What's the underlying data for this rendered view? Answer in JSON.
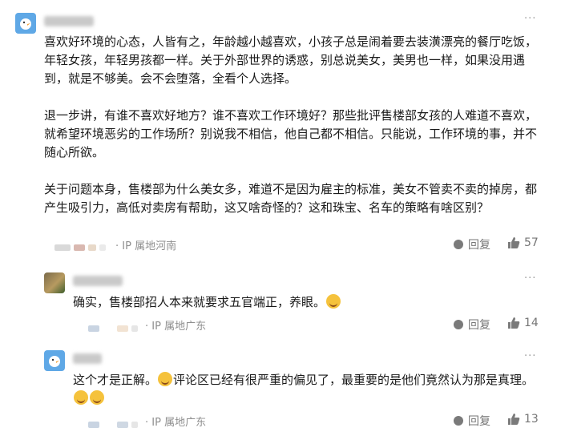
{
  "comments": [
    {
      "ip": "· IP 属地河南",
      "para1": "喜欢好环境的心态，人皆有之，年龄越小越喜欢，小孩子总是闹着要去装潢漂亮的餐厅吃饭，年轻女孩，年轻男孩都一样。关于外部世界的诱惑，别总说美女，美男也一样，如果没用遇到，就是不够美。会不会堕落，全看个人选择。",
      "para2": "退一步讲，有谁不喜欢好地方？谁不喜欢工作环境好？那些批评售楼部女孩的人难道不喜欢，就希望环境恶劣的工作场所？别说我不相信，他自己都不相信。只能说，工作环境的事，并不随心所欲。",
      "para3": "关于问题本身，售楼部为什么美女多，难道不是因为雇主的标准，美女不管卖不卖的掉房，都产生吸引力，高低对卖房有帮助，这又啥奇怪的？这和珠宝、名车的策略有啥区别？",
      "reply_label": "回复",
      "likes": "57"
    },
    {
      "ip": "· IP 属地广东",
      "text": "确实，售楼部招人本来就要求五官端正，养眼。",
      "reply_label": "回复",
      "likes": "14"
    },
    {
      "ip": "· IP 属地广东",
      "text_a": "这个才是正解。",
      "text_b": "评论区已经有很严重的偏见了，最重要的是他们竟然认为那是真理。",
      "reply_label": "回复",
      "likes": "13"
    }
  ],
  "icons": {
    "more": "more-dots-icon",
    "reply": "reply-bubble-icon",
    "like": "thumbs-up-icon",
    "emoji": "laughing-emoji-icon"
  },
  "more_label": "···"
}
